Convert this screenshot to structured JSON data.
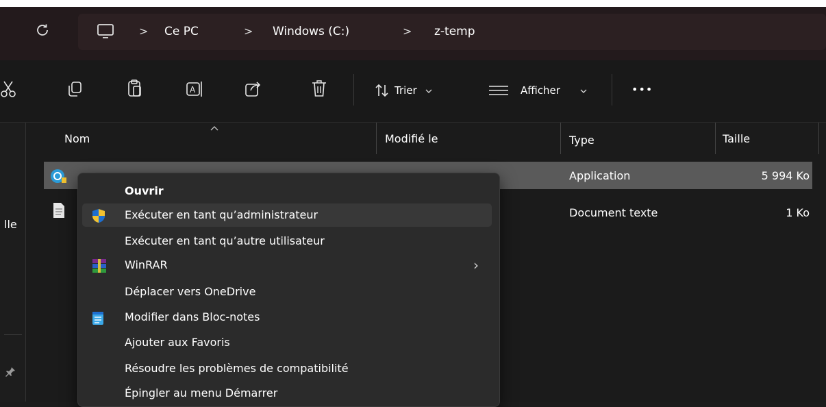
{
  "colors": {
    "accent": "#2a9bd8",
    "selection": "#5a5a5a",
    "menu_bg": "#2b2b2b"
  },
  "address": {
    "refresh_icon": "refresh-icon",
    "pc_icon": "computer-icon",
    "crumbs": [
      "Ce PC",
      "Windows (C:)",
      "z-temp"
    ]
  },
  "toolbar": {
    "sort_label": "Trier",
    "view_label": "Afficher",
    "more_label": "•••"
  },
  "nav": {
    "partial_label": "lle"
  },
  "columns": {
    "name": "Nom",
    "modified": "Modifié le",
    "type": "Type",
    "size": "Taille"
  },
  "files": [
    {
      "type": "Application",
      "size": "5 994 Ko"
    },
    {
      "type": "Document texte",
      "size": "1 Ko"
    }
  ],
  "menu": {
    "items": [
      {
        "label": "Ouvrir"
      },
      {
        "label": "Exécuter en tant qu’administrateur"
      },
      {
        "label": "Exécuter en tant qu’autre utilisateur"
      },
      {
        "label": "WinRAR"
      },
      {
        "label": "Déplacer vers OneDrive"
      },
      {
        "label": "Modifier dans Bloc-notes"
      },
      {
        "label": "Ajouter aux Favoris"
      },
      {
        "label": "Résoudre les problèmes de compatibilité"
      },
      {
        "label": "Épingler au menu Démarrer"
      }
    ],
    "submenu_arrow": "›"
  }
}
